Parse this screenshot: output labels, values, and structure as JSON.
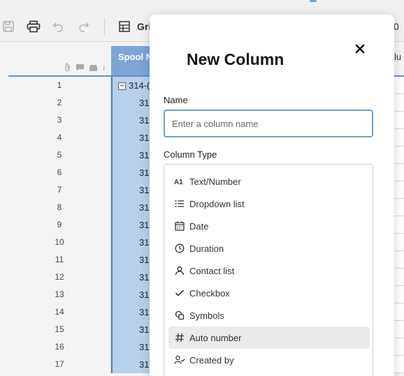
{
  "toolbar": {
    "view_label": "Gri",
    "right_fragment": "0"
  },
  "grid": {
    "primary_column_header": "Spool N",
    "right_column_header": "lu",
    "rows": [
      {
        "num": "1",
        "spool": "314-(",
        "parent": true
      },
      {
        "num": "2",
        "spool": "31"
      },
      {
        "num": "3",
        "spool": "31"
      },
      {
        "num": "4",
        "spool": "31"
      },
      {
        "num": "5",
        "spool": "31"
      },
      {
        "num": "6",
        "spool": "31"
      },
      {
        "num": "7",
        "spool": "31"
      },
      {
        "num": "8",
        "spool": "31"
      },
      {
        "num": "9",
        "spool": "31"
      },
      {
        "num": "10",
        "spool": "31"
      },
      {
        "num": "11",
        "spool": "31"
      },
      {
        "num": "12",
        "spool": "31"
      },
      {
        "num": "13",
        "spool": "31"
      },
      {
        "num": "14",
        "spool": "31"
      },
      {
        "num": "15",
        "spool": "31"
      },
      {
        "num": "16",
        "spool": "31"
      },
      {
        "num": "17",
        "spool": "31"
      }
    ]
  },
  "dialog": {
    "title": "New Column",
    "name_label": "Name",
    "name_placeholder": "Enter a column name",
    "name_value": "",
    "type_label": "Column Type",
    "types": [
      {
        "label": "Text/Number",
        "icon": "text-number-icon"
      },
      {
        "label": "Dropdown list",
        "icon": "dropdown-list-icon"
      },
      {
        "label": "Date",
        "icon": "calendar-icon"
      },
      {
        "label": "Duration",
        "icon": "clock-icon"
      },
      {
        "label": "Contact list",
        "icon": "person-icon"
      },
      {
        "label": "Checkbox",
        "icon": "checkmark-icon"
      },
      {
        "label": "Symbols",
        "icon": "symbols-icon"
      },
      {
        "label": "Auto number",
        "icon": "hash-icon",
        "hovered": true
      },
      {
        "label": "Created by",
        "icon": "person-check-icon"
      }
    ]
  }
}
